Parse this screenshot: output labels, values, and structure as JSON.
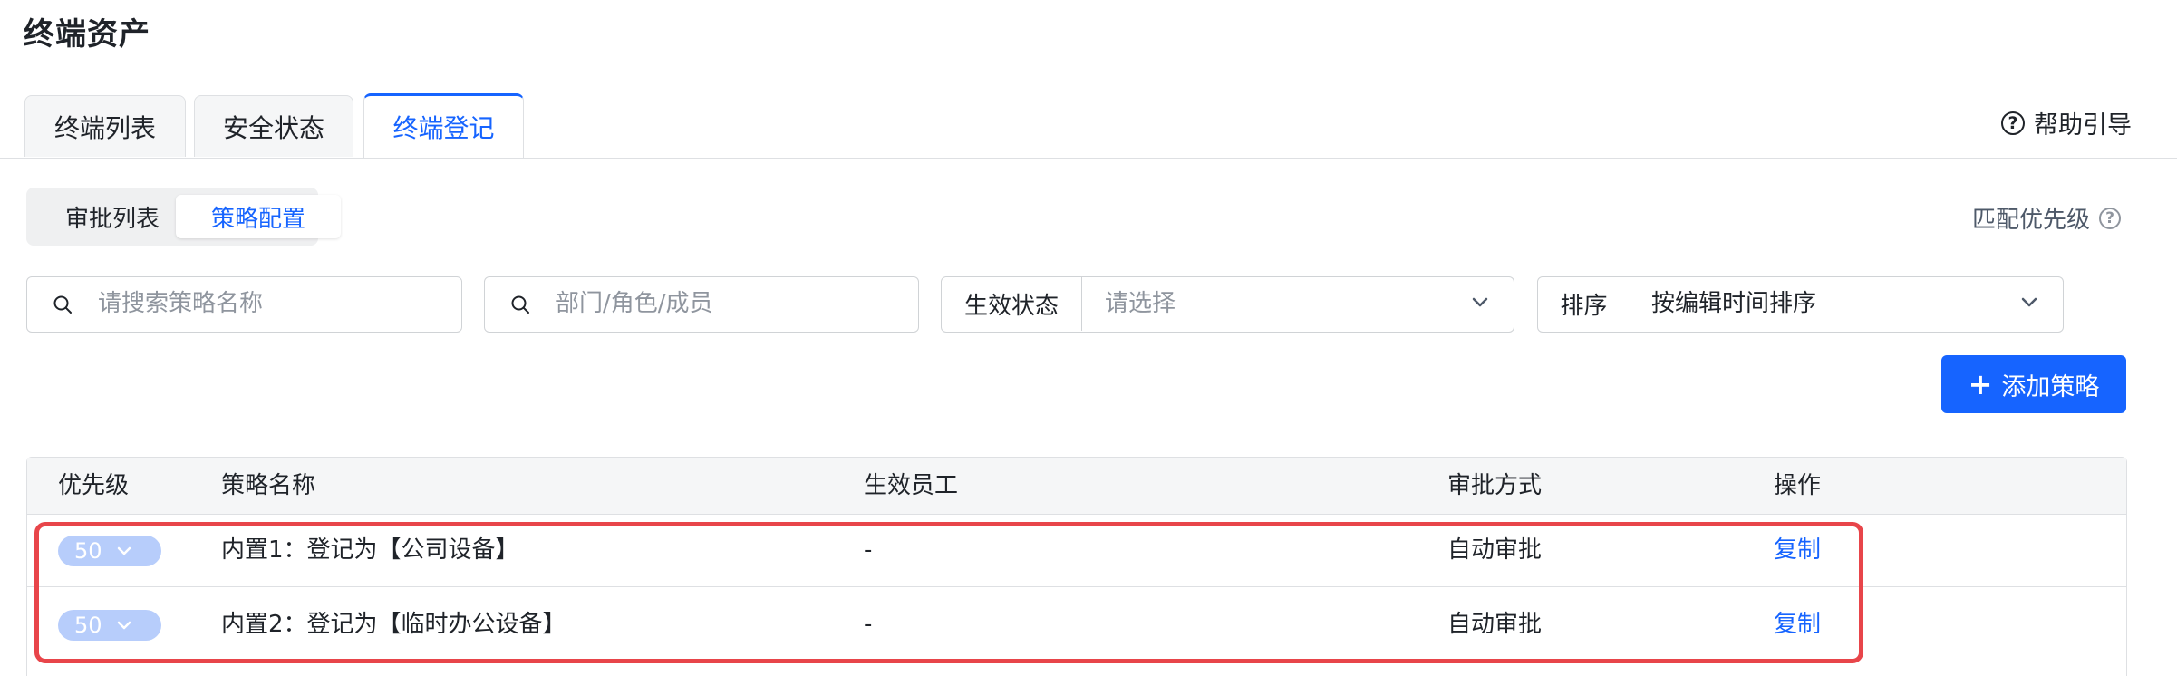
{
  "page": {
    "title": "终端资产"
  },
  "tabs": [
    {
      "label": "终端列表",
      "active": false
    },
    {
      "label": "安全状态",
      "active": false
    },
    {
      "label": "终端登记",
      "active": true
    }
  ],
  "help": {
    "label": "帮助引导",
    "icon": "help-circle-icon"
  },
  "segments": [
    {
      "label": "审批列表",
      "active": false
    },
    {
      "label": "策略配置",
      "active": true
    }
  ],
  "match_priority": {
    "label": "匹配优先级",
    "icon": "help-circle-icon"
  },
  "filters": {
    "policy_search": {
      "placeholder": "请搜索策略名称",
      "icon": "search-icon"
    },
    "member_search": {
      "placeholder": "部门/角色/成员",
      "icon": "search-icon"
    },
    "status": {
      "label": "生效状态",
      "placeholder": "请选择"
    },
    "sort": {
      "label": "排序",
      "value": "按编辑时间排序"
    }
  },
  "add_button": {
    "label": "添加策略",
    "icon": "plus-icon"
  },
  "table": {
    "columns": [
      "优先级",
      "策略名称",
      "生效员工",
      "审批方式",
      "操作"
    ],
    "rows": [
      {
        "priority": "50",
        "name": "内置1：登记为【公司设备】",
        "employees": "-",
        "approval": "自动审批",
        "action": "复制"
      },
      {
        "priority": "50",
        "name": "内置2：登记为【临时办公设备】",
        "employees": "-",
        "approval": "自动审批",
        "action": "复制"
      }
    ]
  },
  "colors": {
    "accent": "#1664ff",
    "highlight": "#e8454a",
    "pill": "#b7cdfb"
  }
}
